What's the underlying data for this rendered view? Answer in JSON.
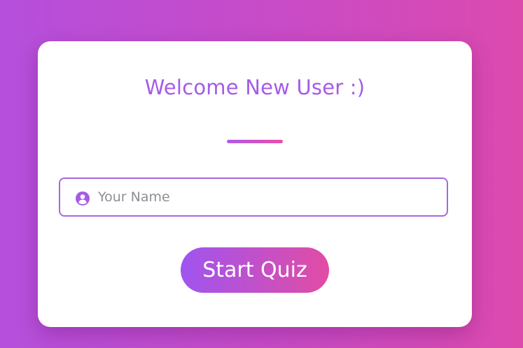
{
  "card": {
    "title": "Welcome New User :)"
  },
  "name_input": {
    "placeholder": "Your Name",
    "value": "",
    "icon": "user-circle-icon"
  },
  "start_button": {
    "label": "Start Quiz"
  },
  "colors": {
    "background_start": "#b54fdc",
    "background_end": "#dc4aae",
    "accent_purple": "#a55be8",
    "accent_pink": "#e24ca4"
  }
}
